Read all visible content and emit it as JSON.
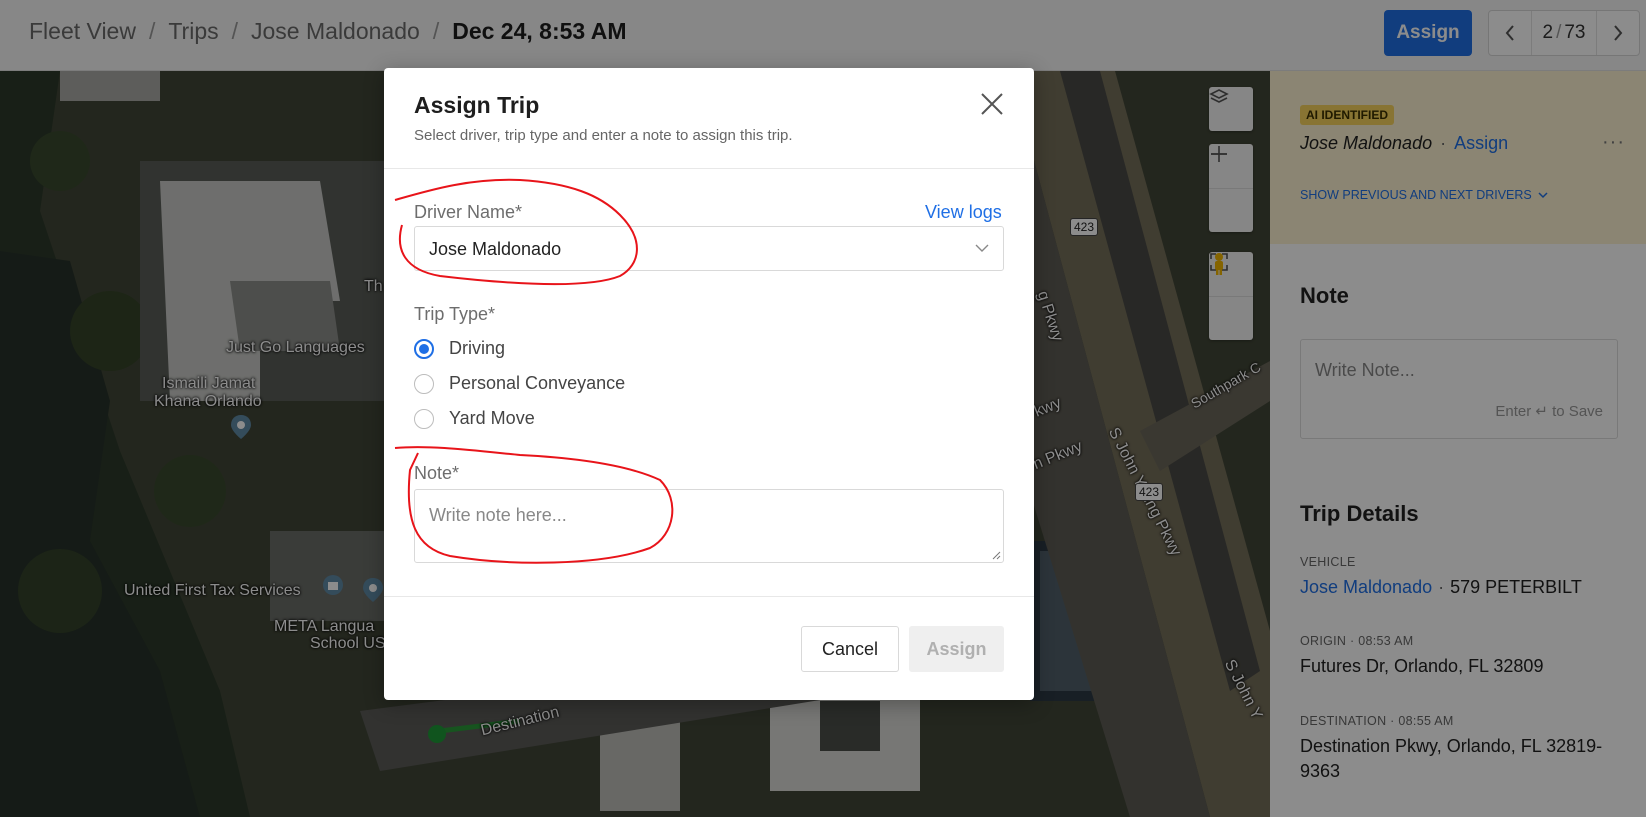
{
  "header": {
    "breadcrumb": [
      "Fleet View",
      "Trips",
      "Jose Maldonado"
    ],
    "current": "Dec 24, 8:53 AM",
    "assign_label": "Assign",
    "pager": {
      "current": "2",
      "total": "73"
    }
  },
  "map": {
    "labels": {
      "just_go": "Just Go Languages",
      "ismaili_1": "Ismaili Jamat",
      "ismaili_2": "Khana Orlando",
      "united_first": "United First Tax Services",
      "meta_1": "META Langua",
      "meta_2": "School US",
      "th": "Th",
      "destination": "Destination",
      "s_john_young": "S John Young Pkwy",
      "s_john": "S John Y",
      "southpark": "Southpark C",
      "pkwy_1": "g Pkwy",
      "pkwy_2": "kwy",
      "pkwy_3": "n Pkwy",
      "shield_423": "423"
    }
  },
  "right_panel": {
    "ai_badge": "AI IDENTIFIED",
    "driver": "Jose Maldonado",
    "assign_link": "Assign",
    "show_drivers": "SHOW PREVIOUS AND NEXT DRIVERS",
    "note_title": "Note",
    "note_placeholder": "Write Note...",
    "note_hint": "Enter ↵ to Save",
    "trip_details_title": "Trip Details",
    "vehicle_label": "VEHICLE",
    "vehicle_driver": "Jose Maldonado",
    "vehicle_name": "579 PETERBILT",
    "origin_label": "ORIGIN",
    "origin_time": "08:53 AM",
    "origin_value": "Futures Dr, Orlando, FL 32809",
    "destination_label": "DESTINATION",
    "destination_time": "08:55 AM",
    "destination_value": "Destination Pkwy, Orlando, FL 32819-9363"
  },
  "modal": {
    "title": "Assign Trip",
    "subtitle": "Select driver, trip type and enter a note to assign this trip.",
    "driver_label": "Driver Name*",
    "view_logs": "View logs",
    "driver_value": "Jose Maldonado",
    "trip_type_label": "Trip Type*",
    "trip_types": [
      "Driving",
      "Personal Conveyance",
      "Yard Move"
    ],
    "selected_trip_type": "Driving",
    "note_label": "Note*",
    "note_placeholder": "Write note here...",
    "cancel_label": "Cancel",
    "assign_label": "Assign"
  },
  "colors": {
    "accent": "#1f6fe5",
    "ai_background": "#fdf3d2",
    "ai_badge": "#f7d35e",
    "annotation": "#e8141a"
  }
}
